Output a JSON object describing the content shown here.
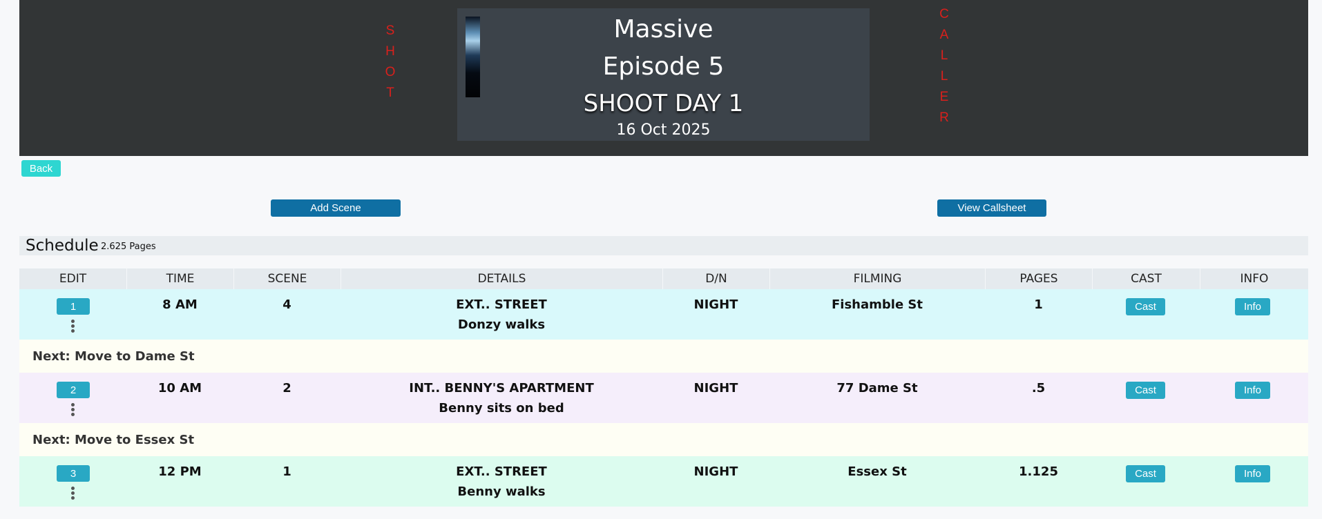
{
  "header": {
    "shot_letters": [
      "S",
      "H",
      "O",
      "T"
    ],
    "caller_letters": [
      "C",
      "A",
      "L",
      "L",
      "E",
      "R"
    ],
    "show": "Massive",
    "episode": "Episode 5",
    "shoot_day": "SHOOT DAY 1",
    "date": "16 Oct 2025",
    "accent_color": "#d9201c"
  },
  "actions": {
    "back": "Back",
    "add_scene": "Add Scene",
    "view_callsheet": "View Callsheet"
  },
  "schedule": {
    "title": "Schedule",
    "pages": "2.625 Pages",
    "columns": [
      "EDIT",
      "TIME",
      "SCENE",
      "DETAILS",
      "D/N",
      "FILMING",
      "PAGES",
      "CAST",
      "INFO"
    ],
    "rows": [
      {
        "num": "1",
        "time": "8 AM",
        "scene": "4",
        "details1": "EXT.. STREET",
        "details2": "Donzy walks",
        "dn": "NIGHT",
        "filming": "Fishamble St",
        "pages": "1",
        "cast": "Cast",
        "info": "Info",
        "bg": "#d9f9fb"
      },
      {
        "num": "2",
        "time": "10 AM",
        "scene": "2",
        "details1": "INT.. BENNY'S APARTMENT",
        "details2": "Benny sits on bed",
        "dn": "NIGHT",
        "filming": "77 Dame St",
        "pages": ".5",
        "cast": "Cast",
        "info": "Info",
        "bg": "#f5eefb"
      },
      {
        "num": "3",
        "time": "12 PM",
        "scene": "1",
        "details1": "EXT.. STREET",
        "details2": "Benny walks",
        "dn": "NIGHT",
        "filming": "Essex St",
        "pages": "1.125",
        "cast": "Cast",
        "info": "Info",
        "bg": "#dcfcef"
      }
    ],
    "moves": [
      "Next: Move to Dame St",
      "Next: Move to Essex St"
    ]
  }
}
